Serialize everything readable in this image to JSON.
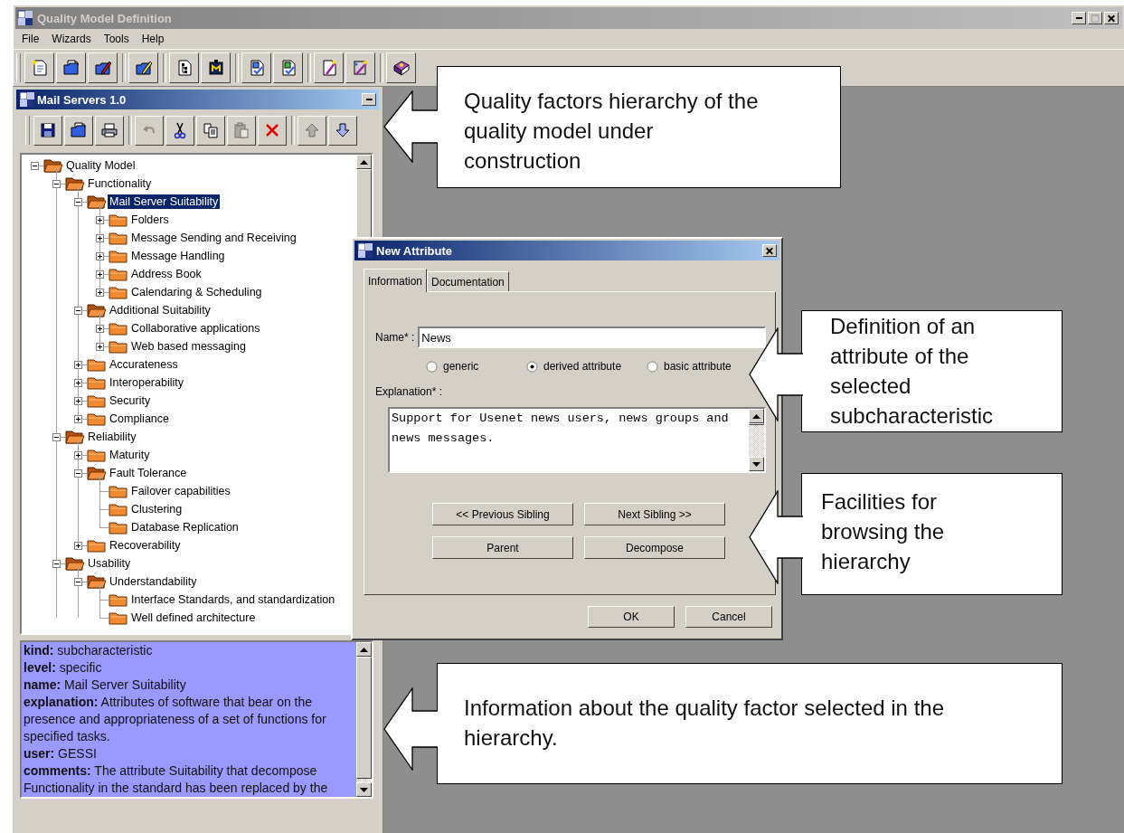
{
  "window": {
    "title": "Quality Model Definition"
  },
  "menu": [
    "File",
    "Wizards",
    "Tools",
    "Help"
  ],
  "toolbar": [
    [
      {
        "kind": "new"
      },
      {
        "kind": "open"
      },
      {
        "kind": "edit_red"
      }
    ],
    [
      {
        "kind": "edit_yellow"
      }
    ],
    [
      {
        "kind": "tree_doc"
      },
      {
        "kind": "board"
      }
    ],
    [
      {
        "kind": "check_blue"
      },
      {
        "kind": "check_green"
      }
    ],
    [
      {
        "kind": "wand_doc"
      },
      {
        "kind": "wand"
      }
    ],
    [
      {
        "kind": "help"
      }
    ]
  ],
  "model_frame": {
    "title": "Mail Servers 1.0",
    "toolbar": [
      [
        {
          "kind": "save",
          "disabled": false
        },
        {
          "kind": "open",
          "disabled": false
        },
        {
          "kind": "print",
          "disabled": false
        }
      ],
      [
        {
          "kind": "undo",
          "disabled": true
        },
        {
          "kind": "cut",
          "disabled": false
        },
        {
          "kind": "copy",
          "disabled": false
        },
        {
          "kind": "paste",
          "disabled": true
        },
        {
          "kind": "delete",
          "disabled": false
        }
      ],
      [
        {
          "kind": "up",
          "disabled": true
        },
        {
          "kind": "down",
          "disabled": false
        }
      ]
    ],
    "tree": [
      {
        "label": "Quality Model",
        "kind": "branch",
        "expanded": true,
        "selected": false,
        "children": [
          {
            "label": "Functionality",
            "kind": "branch",
            "expanded": true,
            "selected": false,
            "children": [
              {
                "label": "Mail Server Suitability",
                "kind": "branch",
                "expanded": true,
                "selected": true,
                "children": [
                  {
                    "label": "Folders",
                    "kind": "branch",
                    "expanded": false,
                    "selected": false
                  },
                  {
                    "label": "Message Sending and Receiving",
                    "kind": "branch",
                    "expanded": false,
                    "selected": false
                  },
                  {
                    "label": "Message Handling",
                    "kind": "branch",
                    "expanded": false,
                    "selected": false
                  },
                  {
                    "label": "Address Book",
                    "kind": "branch",
                    "expanded": false,
                    "selected": false
                  },
                  {
                    "label": "Calendaring & Scheduling",
                    "kind": "branch",
                    "expanded": false,
                    "selected": false
                  }
                ]
              },
              {
                "label": "Additional Suitability",
                "kind": "branch",
                "expanded": true,
                "selected": false,
                "children": [
                  {
                    "label": "Collaborative applications",
                    "kind": "branch",
                    "expanded": false,
                    "selected": false
                  },
                  {
                    "label": "Web based messaging",
                    "kind": "branch",
                    "expanded": false,
                    "selected": false
                  }
                ]
              },
              {
                "label": "Accurateness",
                "kind": "branch",
                "expanded": false,
                "selected": false
              },
              {
                "label": "Interoperability",
                "kind": "branch",
                "expanded": false,
                "selected": false
              },
              {
                "label": "Security",
                "kind": "branch",
                "expanded": false,
                "selected": false
              },
              {
                "label": "Compliance",
                "kind": "branch",
                "expanded": false,
                "selected": false
              }
            ]
          },
          {
            "label": "Reliability",
            "kind": "branch",
            "expanded": true,
            "selected": false,
            "children": [
              {
                "label": "Maturity",
                "kind": "branch",
                "expanded": false,
                "selected": false
              },
              {
                "label": "Fault Tolerance",
                "kind": "branch",
                "expanded": true,
                "selected": false,
                "children": [
                  {
                    "label": "Failover capabilities",
                    "kind": "leaf",
                    "selected": false
                  },
                  {
                    "label": "Clustering",
                    "kind": "leaf",
                    "selected": false
                  },
                  {
                    "label": "Database Replication",
                    "kind": "leaf",
                    "selected": false
                  }
                ]
              },
              {
                "label": "Recoverability",
                "kind": "branch",
                "expanded": false,
                "selected": false
              }
            ]
          },
          {
            "label": "Usability",
            "kind": "branch",
            "expanded": true,
            "selected": false,
            "children": [
              {
                "label": "Understandability",
                "kind": "branch",
                "expanded": true,
                "selected": false,
                "children": [
                  {
                    "label": "Interface Standards, and standardization",
                    "kind": "leaf",
                    "selected": false
                  },
                  {
                    "label": "Well defined architecture",
                    "kind": "leaf",
                    "selected": false
                  }
                ]
              }
            ]
          }
        ]
      }
    ],
    "details": [
      "**kind:** subcharacteristic",
      "**level:** specific",
      "**name:** Mail Server Suitability",
      "**explanation:** Attributes of software that bear on the presence and appropriateness of a set of functions for specified tasks.",
      "**user:** GESSI",
      "**comments:** The attribute Suitability that decompose Functionality in the standard has been replaced by the"
    ]
  },
  "dialog": {
    "title": "New Attribute",
    "tabs": [
      {
        "label": "Information",
        "selected": true
      },
      {
        "label": "Documentation",
        "selected": false
      }
    ],
    "name_label": "Name* :",
    "name_value": "News",
    "radios": [
      {
        "label": "generic",
        "selected": false
      },
      {
        "label": "derived attribute",
        "selected": true
      },
      {
        "label": "basic attribute",
        "selected": false
      }
    ],
    "explanation_label": "Explanation* :",
    "explanation": "Support for Usenet news users, news groups and news messages.",
    "nav_buttons": [
      "<< Previous Sibling",
      "Next Sibling >>",
      "Parent",
      "Decompose"
    ],
    "buttons": [
      "OK",
      "Cancel"
    ]
  },
  "callouts": [
    {
      "text": "Quality factors hierarchy of the\nquality model under\nconstruction"
    },
    {
      "text": "Definition of an\nattribute of the\nselected\nsubcharacteristic"
    },
    {
      "text": "Facilities for\nbrowsing the\nhierarchy"
    },
    {
      "text": "Information about the quality factor selected in the\nhierarchy."
    }
  ]
}
